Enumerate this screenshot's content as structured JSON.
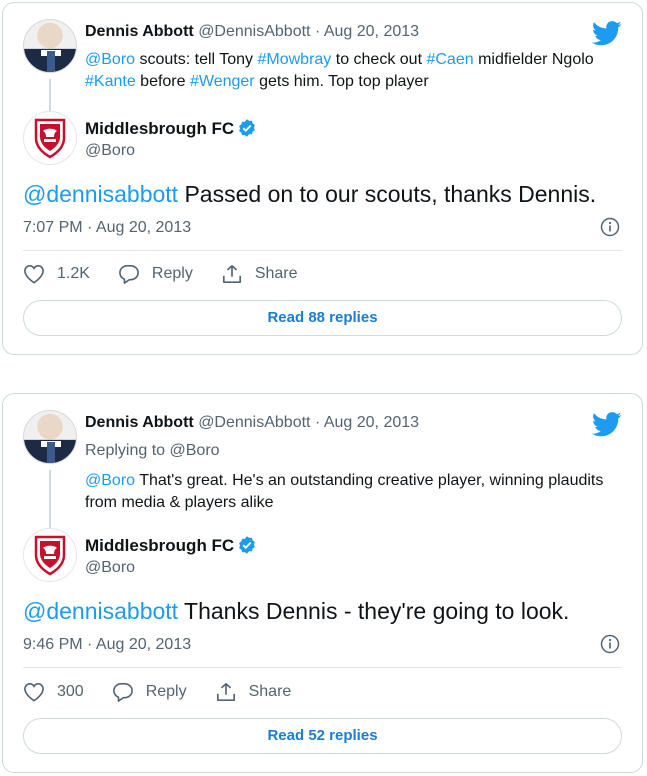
{
  "colors": {
    "link": "#1d9bf0",
    "muted": "#536471",
    "border": "#cfd9de",
    "verified": "#1d9bf0"
  },
  "tweets": [
    {
      "quoted": {
        "name": "Dennis Abbott",
        "handle": "@DennisAbbott",
        "sep": "·",
        "date": "Aug 20, 2013",
        "replying_to": "",
        "text_parts": [
          {
            "text": "@Boro",
            "link": true
          },
          {
            "text": " scouts: tell Tony ",
            "link": false
          },
          {
            "text": "#Mowbray",
            "link": true
          },
          {
            "text": " to check out ",
            "link": false
          },
          {
            "text": "#Caen",
            "link": true
          },
          {
            "text": " midfielder Ngolo ",
            "link": false
          },
          {
            "text": "#Kante",
            "link": true
          },
          {
            "text": " before ",
            "link": false
          },
          {
            "text": "#Wenger",
            "link": true
          },
          {
            "text": " gets him. Top top player",
            "link": false
          }
        ]
      },
      "main": {
        "name": "Middlesbrough FC",
        "handle": "@Boro",
        "mention": "@dennisabbott",
        "text": " Passed on to our scouts, thanks Dennis.",
        "time": "7:07 PM · Aug 20, 2013"
      },
      "likes": "1.2K",
      "reply_label": "Reply",
      "share_label": "Share",
      "read_replies": "Read 88 replies"
    },
    {
      "quoted": {
        "name": "Dennis Abbott",
        "handle": "@DennisAbbott",
        "sep": "·",
        "date": "Aug 20, 2013",
        "replying_prefix": "Replying to ",
        "replying_to": "@Boro",
        "text_parts": [
          {
            "text": "@Boro",
            "link": true
          },
          {
            "text": " That's great. He's an outstanding creative player, winning plaudits from media & players alike",
            "link": false
          }
        ]
      },
      "main": {
        "name": "Middlesbrough FC",
        "handle": "@Boro",
        "mention": "@dennisabbott",
        "text": " Thanks Dennis - they're going to look.",
        "time": "9:46 PM · Aug 20, 2013"
      },
      "likes": "300",
      "reply_label": "Reply",
      "share_label": "Share",
      "read_replies": "Read 52 replies"
    }
  ]
}
